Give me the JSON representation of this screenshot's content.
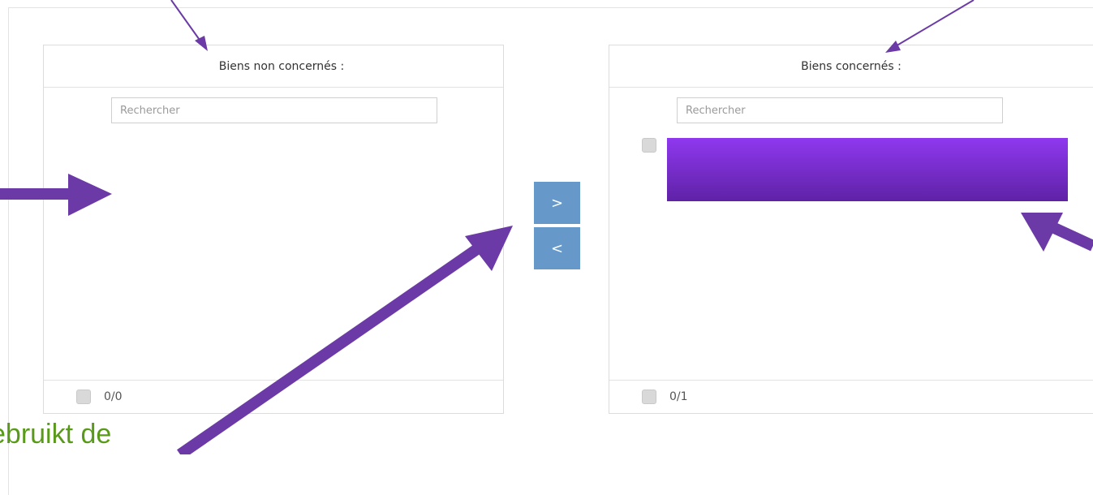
{
  "left_panel": {
    "title": "Biens non concernés :",
    "search_placeholder": "Rechercher",
    "counter": "0/0",
    "items": []
  },
  "right_panel": {
    "title": "Biens concernés :",
    "search_placeholder": "Rechercher",
    "counter": "0/1",
    "items": [
      {
        "label": "",
        "redacted": true,
        "checked": false
      }
    ]
  },
  "transfer_buttons": {
    "move_right_label": ">",
    "move_left_label": "<"
  },
  "annotation": {
    "overlay_text": "ebruikt de",
    "arrow_color": "#6b3aa6",
    "text_color": "#5a9a1a"
  },
  "colors": {
    "button_bg": "#6699c9",
    "redaction_top": "#8f38ef",
    "redaction_bottom": "#5f22a6"
  }
}
